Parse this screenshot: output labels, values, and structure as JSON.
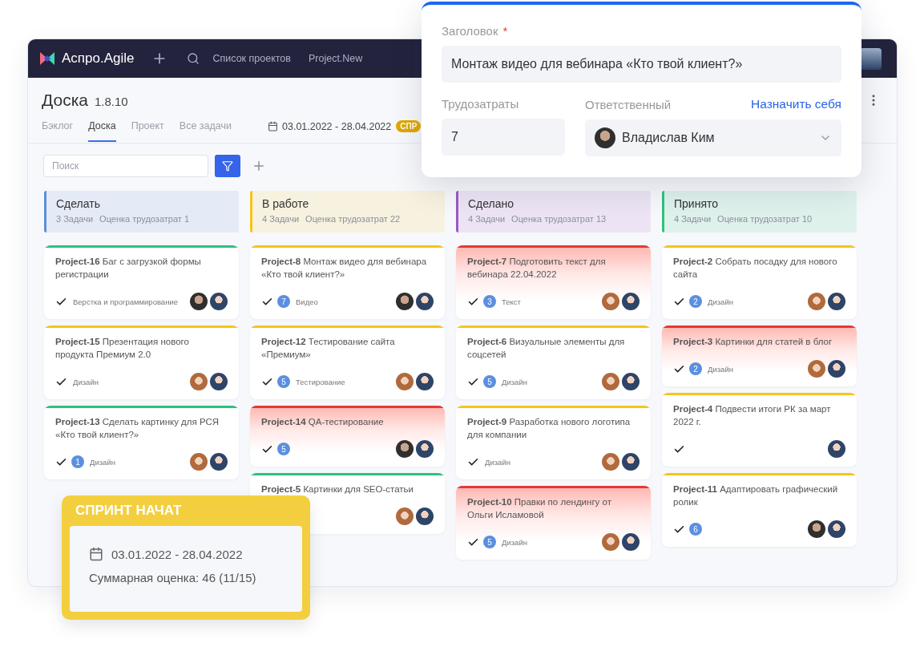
{
  "topbar": {
    "brand": "Аспро.Agile",
    "links": [
      "Список проектов",
      "Project.New"
    ]
  },
  "header": {
    "title": "Доска",
    "version": "1.8.10"
  },
  "tabs": [
    {
      "label": "Бэклог",
      "selected": false
    },
    {
      "label": "Доска",
      "selected": true
    },
    {
      "label": "Проект",
      "selected": false
    },
    {
      "label": "Все задачи",
      "selected": false
    }
  ],
  "sprint_dates": "03.01.2022 - 28.04.2022",
  "sprint_badge": "СПР",
  "search": {
    "placeholder": "Поиск"
  },
  "columns": [
    {
      "title": "Сделать",
      "color": "#5b8fd6",
      "count": "3 Задачи",
      "estimate": "Оценка трудозатрат 1",
      "cards": [
        {
          "text": "**Project-16** Баг с загрузкой формы регистрации",
          "color": "#2ec27e",
          "highlighted": false,
          "tag": "Верстка и программирование",
          "avatars": [
            {
              "kind": "dark"
            },
            {
              "kind": "man"
            }
          ]
        },
        {
          "text": "**Project-15** Презентация нового продукта Премиум 2.0",
          "color": "#f5c518",
          "highlighted": false,
          "tag": "Дизайн",
          "avatars": [
            {
              "kind": "woman"
            },
            {
              "kind": "man"
            }
          ]
        },
        {
          "text": "**Project-13** Сделать картинку для РСЯ «Кто твой клиент?»",
          "color": "#2ec27e",
          "highlighted": false,
          "count": "1",
          "tag": "Дизайн",
          "avatars": [
            {
              "kind": "woman"
            },
            {
              "kind": "man"
            }
          ]
        }
      ]
    },
    {
      "title": "В работе",
      "color": "#f5c518",
      "count": "4 Задачи",
      "estimate": "Оценка трудозатрат 22",
      "cards": [
        {
          "text": "**Project-8** Монтаж видео для вебинара «Кто твой клиент?»",
          "color": "#f5c518",
          "highlighted": false,
          "count": "7",
          "tag": "Видео",
          "avatars": [
            {
              "kind": "dark"
            },
            {
              "kind": "man"
            }
          ]
        },
        {
          "text": "**Project-12** Тестирование сайта «Премиум»",
          "color": "#f5c518",
          "highlighted": false,
          "count": "5",
          "tag": "Тестирование",
          "avatars": [
            {
              "kind": "woman"
            },
            {
              "kind": "man"
            }
          ]
        },
        {
          "text": "**Project-14** QA-тестирование",
          "color": "#e53935",
          "highlighted": true,
          "count": "5",
          "avatars": [
            {
              "kind": "dark"
            },
            {
              "kind": "man"
            }
          ]
        },
        {
          "text": "**Project-5** Картинки для SEO-статьи",
          "color": "#2ec27e",
          "highlighted": false,
          "avatars": [
            {
              "kind": "woman"
            },
            {
              "kind": "man"
            }
          ]
        }
      ]
    },
    {
      "title": "Сделано",
      "color": "#9b59c6",
      "count": "4 Задачи",
      "estimate": "Оценка трудозатрат 13",
      "cards": [
        {
          "text": "**Project-7** Подготовить текст для вебинара 22.04.2022",
          "color": "#e53935",
          "highlighted": true,
          "count": "3",
          "tag": "Текст",
          "avatars": [
            {
              "kind": "woman"
            },
            {
              "kind": "man"
            }
          ]
        },
        {
          "text": "**Project-6** Визуальные элементы для соцсетей",
          "color": "#f5c518",
          "highlighted": false,
          "count": "5",
          "tag": "Дизайн",
          "avatars": [
            {
              "kind": "woman"
            },
            {
              "kind": "man"
            }
          ]
        },
        {
          "text": "**Project-9** Разработка нового логотипа для компании",
          "color": "#f5c518",
          "highlighted": false,
          "tag": "Дизайн",
          "avatars": [
            {
              "kind": "woman"
            },
            {
              "kind": "man"
            }
          ]
        },
        {
          "text": "**Project-10** Правки по лендингу от Ольги Исламовой",
          "color": "#e53935",
          "highlighted": true,
          "count": "5",
          "tag": "Дизайн",
          "avatars": [
            {
              "kind": "woman"
            },
            {
              "kind": "man"
            }
          ]
        }
      ]
    },
    {
      "title": "Принято",
      "color": "#2ec27e",
      "count": "4 Задачи",
      "estimate": "Оценка трудозатрат 10",
      "cards": [
        {
          "text": "**Project-2** Собрать посадку для нового сайта",
          "color": "#f5c518",
          "highlighted": false,
          "count": "2",
          "tag": "Дизайн",
          "avatars": [
            {
              "kind": "woman"
            },
            {
              "kind": "man"
            }
          ]
        },
        {
          "text": "**Project-3** Картинки для статей в блог",
          "color": "#e53935",
          "highlighted": true,
          "count": "2",
          "tag": "Дизайн",
          "avatars": [
            {
              "kind": "woman"
            },
            {
              "kind": "man"
            }
          ]
        },
        {
          "text": "**Project-4** Подвести итоги РК за март 2022 г.",
          "color": "#f5c518",
          "highlighted": false,
          "avatars": [
            {
              "kind": "man"
            }
          ]
        },
        {
          "text": "**Project-11** Адаптировать графический ролик",
          "color": "#f5c518",
          "highlighted": false,
          "count": "6",
          "avatars": [
            {
              "kind": "dark"
            },
            {
              "kind": "man"
            }
          ]
        }
      ]
    }
  ],
  "task_popup": {
    "title_label": "Заголовок",
    "required_mark": "*",
    "title_value": "Монтаж видео для вебинара «Кто твой клиент?»",
    "effort_label": "Трудозатраты",
    "effort_value": "7",
    "assignee_label": "Ответственный",
    "assign_self": "Назначить себя",
    "assignee": "Владислав Ким"
  },
  "sprint_card": {
    "title": "СПРИНТ НАЧАТ",
    "dates": "03.01.2022 - 28.04.2022",
    "summary": "Суммарная оценка: 46 (11/15)"
  }
}
